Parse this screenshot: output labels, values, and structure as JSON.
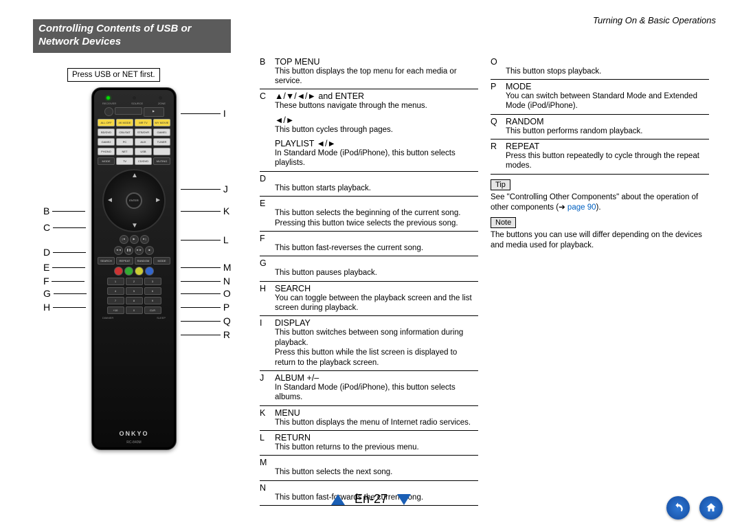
{
  "header": {
    "breadcrumb": "Turning On & Basic Operations"
  },
  "section": {
    "title": "Controlling Contents of USB or Network Devices"
  },
  "remote": {
    "note": "Press USB or NET first.",
    "brand": "ONKYO",
    "model": "RC-840M",
    "labels_top": [
      "RECEIVER",
      "SOURCE",
      "ZONE"
    ],
    "row_white1": [
      "BD/DVD",
      "CBL/SAT",
      "STB/DVR",
      "GAME1"
    ],
    "row_white2": [
      "GAME2",
      "PC",
      "AUX",
      "TUNER"
    ],
    "row_white3": [
      "PHONO",
      "NET",
      "USB"
    ],
    "row_mode": [
      "MODE",
      "TV",
      "CD/DVD",
      "MUTING"
    ],
    "row_yellow": [
      "ALL OFF",
      "4K MODE",
      "MR TV",
      "MY MOVIE"
    ],
    "center": "ENTER",
    "bottom_row": [
      "SEARCH",
      "REPEAT",
      "RANDOM",
      "MODE"
    ],
    "color_row": [
      "R",
      "G",
      "Y",
      "B"
    ],
    "num": [
      "1",
      "2",
      "3",
      "4",
      "5",
      "6",
      "7",
      "8",
      "9",
      "+10",
      "0",
      "CLR"
    ],
    "bottom_labels": [
      "DIMMER",
      "SLEEP"
    ]
  },
  "callouts": {
    "left": [
      "B",
      "C",
      "D",
      "E",
      "F",
      "G",
      "H"
    ],
    "right": [
      "I",
      "J",
      "K",
      "L",
      "M",
      "N",
      "O",
      "P",
      "Q",
      "R"
    ]
  },
  "col1": [
    {
      "letter": "B",
      "name": "TOP MENU",
      "desc": "This button displays the top menu for each media or service."
    },
    {
      "letter": "C",
      "name_html": "▲/▼/◄/► and ENTER",
      "desc": "These buttons navigate through the menus.",
      "subs": [
        {
          "name": "◄/►",
          "desc": "This button cycles through pages."
        },
        {
          "name": "PLAYLIST ◄/►",
          "desc": "In Standard Mode (iPod/iPhone), this button selects playlists."
        }
      ]
    },
    {
      "letter": "D",
      "name": "",
      "desc": "This button starts playback."
    },
    {
      "letter": "E",
      "name": "",
      "desc": "This button selects the beginning of the current song. Pressing this button twice selects the previous song."
    },
    {
      "letter": "F",
      "name": "",
      "desc": "This button fast-reverses the current song."
    },
    {
      "letter": "G",
      "name": "",
      "desc": "This button pauses playback."
    },
    {
      "letter": "H",
      "name": "SEARCH",
      "desc": "You can toggle between the playback screen and the list screen during playback."
    },
    {
      "letter": "I",
      "name": "DISPLAY",
      "desc": "This button switches between song information during playback.",
      "extra": "Press this button while the list screen is displayed to return to the playback screen."
    },
    {
      "letter": "J",
      "name": "ALBUM +/–",
      "desc": "In Standard Mode (iPod/iPhone), this button selects albums."
    },
    {
      "letter": "K",
      "name": "MENU",
      "desc": "This button displays the menu of Internet radio services."
    },
    {
      "letter": "L",
      "name": "RETURN",
      "desc": "This button returns to the previous menu."
    },
    {
      "letter": "M",
      "name": "",
      "desc": "This button selects the next song."
    },
    {
      "letter": "N",
      "name": "",
      "desc": "This button fast-forwards the current song."
    }
  ],
  "col2": [
    {
      "letter": "O",
      "name": "",
      "desc": "This button stops playback."
    },
    {
      "letter": "P",
      "name": "MODE",
      "desc": "You can switch between Standard Mode and Extended Mode (iPod/iPhone)."
    },
    {
      "letter": "Q",
      "name": "RANDOM",
      "desc": "This button performs random playback."
    },
    {
      "letter": "R",
      "name": "REPEAT",
      "desc": "Press this button repeatedly to cycle through the repeat modes."
    }
  ],
  "tip": {
    "label": "Tip",
    "text_pre": "See \"Controlling Other Components\" about the operation of other components (➔ ",
    "link": "page 90",
    "text_post": ")."
  },
  "notebox": {
    "label": "Note",
    "text": "The buttons you can use will differ depending on the devices and media used for playback."
  },
  "footer": {
    "page": "En-27"
  }
}
